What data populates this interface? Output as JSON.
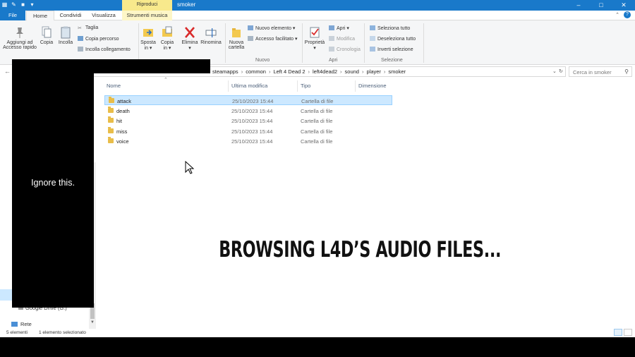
{
  "titlebar": {
    "context_tab": "Riproduci",
    "title": "smoker",
    "min": "–",
    "max": "□",
    "close": "✕"
  },
  "tabs": {
    "file": "File",
    "home": "Home",
    "share": "Condividi",
    "view": "Visualizza",
    "music": "Strumenti musica"
  },
  "ribbon": {
    "pin_line1": "Aggiungi ad",
    "pin_line2": "Accesso rapido",
    "copy": "Copia",
    "paste": "Incolla",
    "cut": "Taglia",
    "copy_path": "Copia percorso",
    "paste_link": "Incolla collegamento",
    "move_line1": "Sposta",
    "move_line2": "in ▾",
    "copyto_line1": "Copia",
    "copyto_line2": "in ▾",
    "delete_line1": "Elimina",
    "delete_line2": "▾",
    "rename": "Rinomina",
    "newfolder_line1": "Nuova",
    "newfolder_line2": "cartella",
    "new_item": "Nuovo elemento ▾",
    "easy_access": "Accesso facilitato ▾",
    "group_new": "Nuovo",
    "props_line1": "Proprietà",
    "props_line2": "▾",
    "open": "Apri ▾",
    "edit": "Modifica",
    "history": "Cronologia",
    "group_open": "Apri",
    "select_all": "Seleziona tutto",
    "select_none": "Deseleziona tutto",
    "invert": "Inverti selezione",
    "group_select": "Selezione"
  },
  "address": {
    "crumbs": [
      "steamapps",
      "common",
      "Left 4 Dead 2",
      "left4dead2",
      "sound",
      "player",
      "smoker"
    ],
    "search_placeholder": "Cerca in smoker"
  },
  "columns": {
    "name": "Nome",
    "modified": "Ultima modifica",
    "type": "Tipo",
    "size": "Dimensione"
  },
  "files": [
    {
      "name": "attack",
      "date": "25/10/2023 15:44",
      "type": "Cartella di file"
    },
    {
      "name": "death",
      "date": "25/10/2023 15:44",
      "type": "Cartella di file"
    },
    {
      "name": "hit",
      "date": "25/10/2023 15:44",
      "type": "Cartella di file"
    },
    {
      "name": "miss",
      "date": "25/10/2023 15:44",
      "type": "Cartella di file"
    },
    {
      "name": "voice",
      "date": "25/10/2023 15:44",
      "type": "Cartella di file"
    }
  ],
  "navpane": {
    "gdrive": "Google Drive (G:)",
    "network": "Rete"
  },
  "status": {
    "count": "5 elementi",
    "selected": "1 elemento selezionato"
  },
  "overlay": {
    "ignore": "Ignore this.",
    "caption": "BROWSING L4D’S AUDIO FILES..."
  },
  "colors": {
    "titlebar": "#1979ca",
    "context_tab": "#f8e98c",
    "selection": "#cce8ff",
    "folder": "#e9bd49"
  }
}
